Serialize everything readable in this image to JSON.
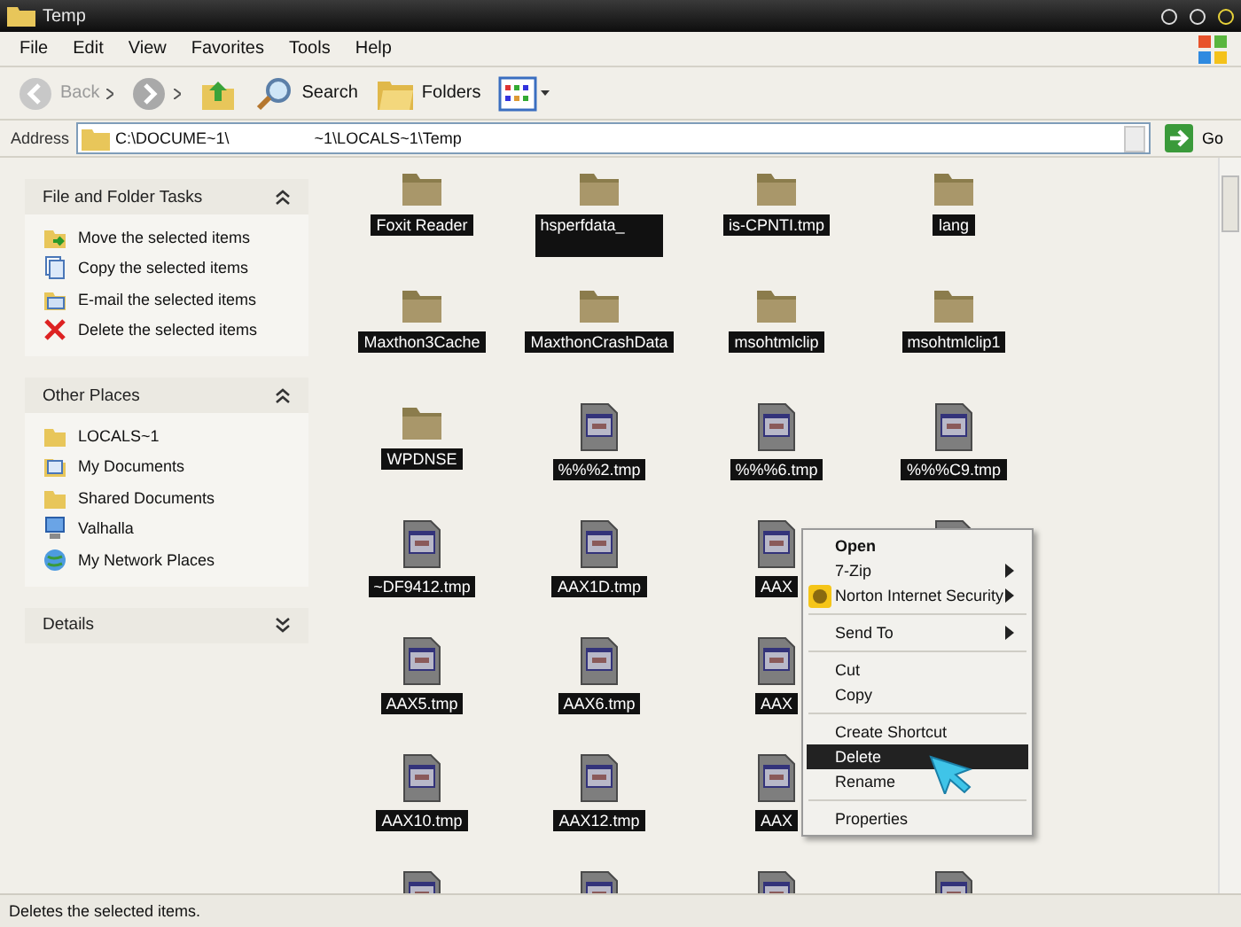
{
  "window": {
    "title": "Temp"
  },
  "menu_bar": [
    "File",
    "Edit",
    "View",
    "Favorites",
    "Tools",
    "Help"
  ],
  "toolbar": [
    {
      "kind": "back",
      "label": "Back",
      "disabled": true
    },
    {
      "kind": "forward",
      "disabled": false
    },
    {
      "kind": "up"
    },
    {
      "kind": "search",
      "label": "Search"
    },
    {
      "kind": "folders",
      "label": "Folders"
    },
    {
      "kind": "views"
    }
  ],
  "address": {
    "label": "Address",
    "value_parts": [
      "C:\\DOCUME~1\\",
      "~1\\LOCALS~1\\Temp"
    ],
    "go": "Go"
  },
  "sidebar": [
    {
      "title": "File and Folder Tasks",
      "expanded": true,
      "items": [
        {
          "kind": "move",
          "label": "Move the selected items"
        },
        {
          "kind": "copy",
          "label": "Copy the selected items"
        },
        {
          "kind": "email",
          "label": "E-mail the selected items"
        },
        {
          "kind": "delete",
          "label": "Delete the selected items"
        }
      ]
    },
    {
      "title": "Other Places",
      "expanded": true,
      "items": [
        {
          "kind": "folder",
          "label": "LOCALS~1"
        },
        {
          "kind": "documents",
          "label": "My Documents"
        },
        {
          "kind": "folder",
          "label": "Shared Documents"
        },
        {
          "kind": "computer",
          "label": "Valhalla"
        },
        {
          "kind": "network",
          "label": "My Network Places"
        }
      ]
    },
    {
      "title": "Details",
      "expanded": false
    }
  ],
  "files": [
    {
      "kind": "folder",
      "label": "Foxit Reader",
      "selected": true,
      "redacted": false
    },
    {
      "kind": "folder",
      "label": "hsperfdata_",
      "selected": true,
      "redacted": true
    },
    {
      "kind": "folder",
      "label": "is-CPNTI.tmp",
      "selected": true,
      "redacted": false
    },
    {
      "kind": "folder",
      "label": "lang",
      "selected": true,
      "redacted": false
    },
    {
      "kind": "folder",
      "label": "Maxthon3Cache",
      "selected": true,
      "redacted": false
    },
    {
      "kind": "folder",
      "label": "MaxthonCrashData",
      "selected": true,
      "redacted": false
    },
    {
      "kind": "folder",
      "label": "msohtmlclip",
      "selected": true,
      "redacted": false
    },
    {
      "kind": "folder",
      "label": "msohtmlclip1",
      "selected": true,
      "redacted": false
    },
    {
      "kind": "folder",
      "label": "WPDNSE",
      "selected": true,
      "redacted": false
    },
    {
      "kind": "file",
      "label": "%%%2.tmp",
      "selected": true,
      "redacted": false
    },
    {
      "kind": "file",
      "label": "%%%6.tmp",
      "selected": true,
      "redacted": false
    },
    {
      "kind": "file",
      "label": "%%%C9.tmp",
      "selected": true,
      "redacted": false
    },
    {
      "kind": "file",
      "label": "~DF9412.tmp",
      "selected": true,
      "redacted": false
    },
    {
      "kind": "file",
      "label": "AAX1D.tmp",
      "selected": true,
      "redacted": false
    },
    {
      "kind": "file",
      "label": "AAX",
      "selected": true,
      "redacted": false
    },
    {
      "kind": "file"
    },
    {
      "kind": "file",
      "label": "AAX5.tmp",
      "selected": true,
      "redacted": false
    },
    {
      "kind": "file",
      "label": "AAX6.tmp",
      "selected": true,
      "redacted": false
    },
    {
      "kind": "file",
      "label": "AAX",
      "selected": true,
      "redacted": false
    },
    {
      "kind": "blank"
    },
    {
      "kind": "file",
      "label": "AAX10.tmp",
      "selected": true,
      "redacted": false
    },
    {
      "kind": "file",
      "label": "AAX12.tmp",
      "selected": true,
      "redacted": false
    },
    {
      "kind": "file",
      "label": "AAX",
      "selected": true,
      "redacted": false
    },
    {
      "kind": "blank"
    },
    {
      "kind": "file"
    },
    {
      "kind": "file"
    },
    {
      "kind": "file"
    },
    {
      "kind": "file"
    }
  ],
  "context_menu": [
    {
      "kind": "item",
      "label": "Open",
      "default": true,
      "submenu": false,
      "selected": false
    },
    {
      "kind": "item",
      "label": "7-Zip",
      "default": false,
      "submenu": true,
      "selected": false
    },
    {
      "kind": "icon_item",
      "label": "Norton Internet Security",
      "default": false,
      "submenu": true,
      "selected": false
    },
    {
      "kind": "separator"
    },
    {
      "kind": "item",
      "label": "Send To",
      "default": false,
      "submenu": true,
      "selected": false
    },
    {
      "kind": "separator"
    },
    {
      "kind": "item",
      "label": "Cut",
      "default": false,
      "submenu": false,
      "selected": false
    },
    {
      "kind": "item",
      "label": "Copy",
      "default": false,
      "submenu": false,
      "selected": false
    },
    {
      "kind": "separator"
    },
    {
      "kind": "item",
      "label": "Create Shortcut",
      "default": false,
      "submenu": false,
      "selected": false
    },
    {
      "kind": "item",
      "label": "Delete",
      "default": false,
      "submenu": false,
      "selected": true
    },
    {
      "kind": "item",
      "label": "Rename",
      "default": false,
      "submenu": false,
      "selected": false
    },
    {
      "kind": "separator"
    },
    {
      "kind": "item",
      "label": "Properties",
      "default": false,
      "submenu": false,
      "selected": false
    }
  ],
  "status_bar": "Deletes the selected items."
}
